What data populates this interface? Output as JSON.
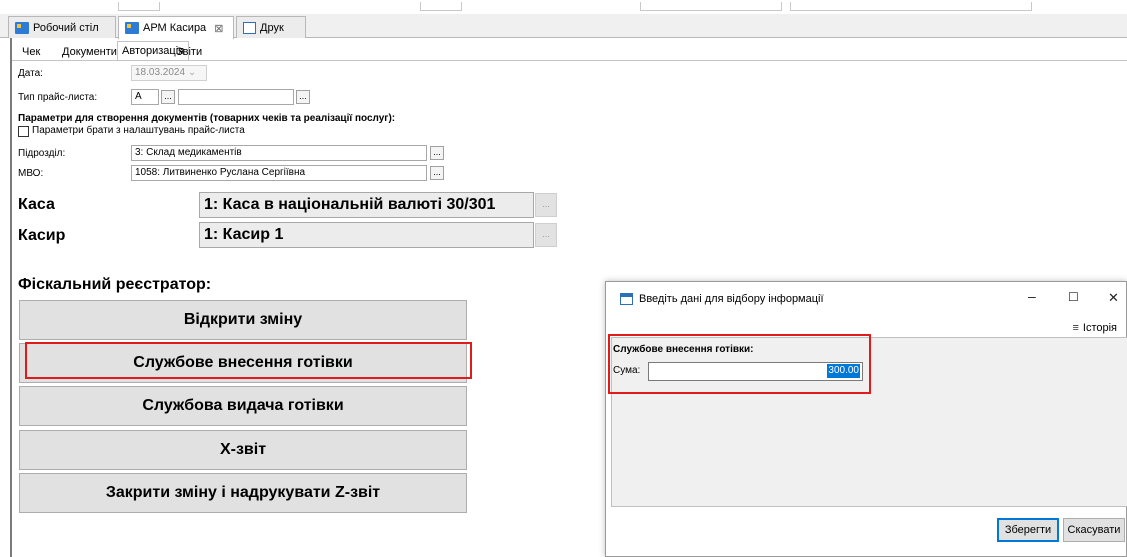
{
  "tabs": [
    {
      "label": "Робочий стіл",
      "icon": "app-icon"
    },
    {
      "label": "АРМ Касира",
      "icon": "app-icon",
      "active": true,
      "close": "⊠"
    },
    {
      "label": "Друк",
      "icon": "print-icon"
    }
  ],
  "subtabs": [
    "Чек",
    "Документи",
    "Авторизація",
    "Звіти"
  ],
  "form": {
    "date_label": "Дата:",
    "date_value": "18.03.2024",
    "pricelist_label": "Тип прайс-листа:",
    "pricelist_value": "А",
    "params_header": "Параметри для створення документів (товарних чеків та реалізації послуг):",
    "params_checkbox": "Параметри брати з налаштувань прайс-листа",
    "division_label": "Підрозділ:",
    "division_value": "3: Склад медикаментів",
    "mvo_label": "МВО:",
    "mvo_value": "1058: Литвиненко Руслана Сергіївна",
    "dots": "..."
  },
  "kasa": {
    "label": "Каса",
    "value": "1: Каса в національній валюті 30/301"
  },
  "kasir": {
    "label": "Касир",
    "value": "1: Касир 1"
  },
  "fiscal": {
    "header": "Фіскальний реєстратор:",
    "buttons": [
      "Відкрити зміну",
      "Службове внесення готівки",
      "Службова видача готівки",
      "X-звіт",
      "Закрити зміну і надрукувати Z-звіт"
    ]
  },
  "dialog": {
    "title": "Введіть дані для відбору інформації",
    "minimize": "–",
    "maximize": "☐",
    "close": "✕",
    "history_label": "Історія",
    "section_header": "Службове внесення готівки:",
    "sum_label": "Сума:",
    "sum_value": "300.00",
    "save": "Зберегти",
    "cancel": "Скасувати"
  },
  "colors": {
    "highlight": "#e01b1b",
    "selection": "#0078d7"
  }
}
